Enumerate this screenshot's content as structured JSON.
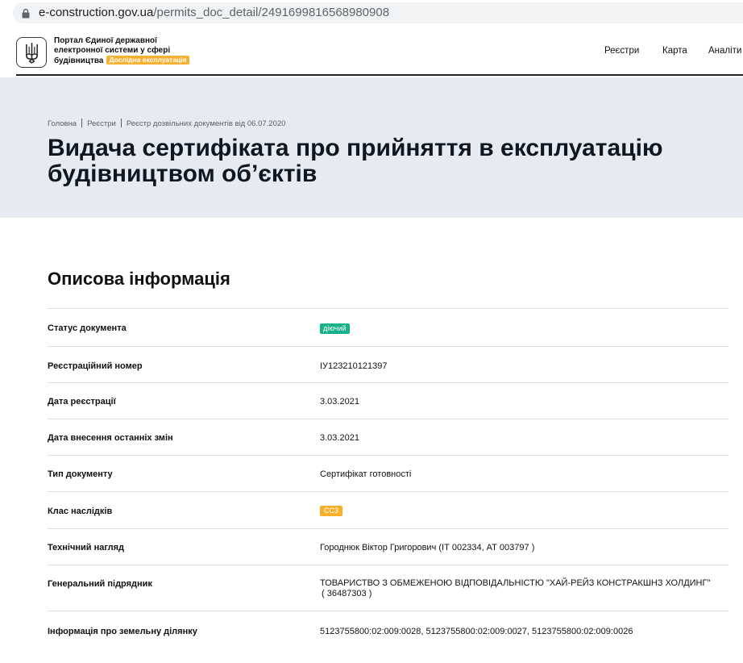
{
  "browser": {
    "url_host": "e-construction.gov.ua",
    "url_path": "/permits_doc_detail/2491699816568980908"
  },
  "header": {
    "portal_line1": "Портал Єдиної державної",
    "portal_line2": "електронної системи у сфері",
    "portal_line3": "будівництва",
    "beta_badge": "Дослідна експлуатація",
    "nav": [
      "Реєстри",
      "Карта",
      "Аналіти"
    ]
  },
  "hero": {
    "breadcrumb": [
      "Головна",
      "Реєстри",
      "Реєстр дозвільних документів від 06.07.2020"
    ],
    "title_line1": "Видача сертифіката про прийняття в експлуатацію",
    "title_line2": "будівництвом об’єктів"
  },
  "section": {
    "title": "Описова інформація",
    "rows": [
      {
        "label": "Статус документа",
        "value": "діючий"
      },
      {
        "label": "Реєстраційний номер",
        "value": "ІУ123210121397"
      },
      {
        "label": "Дата реєстрації",
        "value": "3.03.2021"
      },
      {
        "label": "Дата внесення останніх змін",
        "value": "3.03.2021"
      },
      {
        "label": "Тип документу",
        "value": "Сертифікат готовності"
      },
      {
        "label": "Клас наслідків",
        "value": "СС3"
      },
      {
        "label": "Технічний нагляд",
        "value": "Городнюк Віктор Григорович (ІТ 002334, АТ 003797 )"
      },
      {
        "label": "Генеральний підрядник",
        "value": "ТОВАРИСТВО З ОБМЕЖЕНОЮ ВІДПОВІДАЛЬНІСТЮ \"ХАЙ-РЕЙЗ КОНСТРАКШНЗ ХОЛДИНГ\"",
        "value_line2": "( 36487303 )"
      },
      {
        "label": "Інформація про земельну ділянку",
        "value": "5123755800:02:009:0028, 5123755800:02:009:0027, 5123755800:02:009:0026"
      }
    ]
  },
  "colors": {
    "hero_bg": "#e7ebf1",
    "status_active": "#18b28a",
    "badge_orange": "#f6b02a"
  },
  "icons": {
    "lock": "lock-icon",
    "trident": "trident-icon"
  }
}
